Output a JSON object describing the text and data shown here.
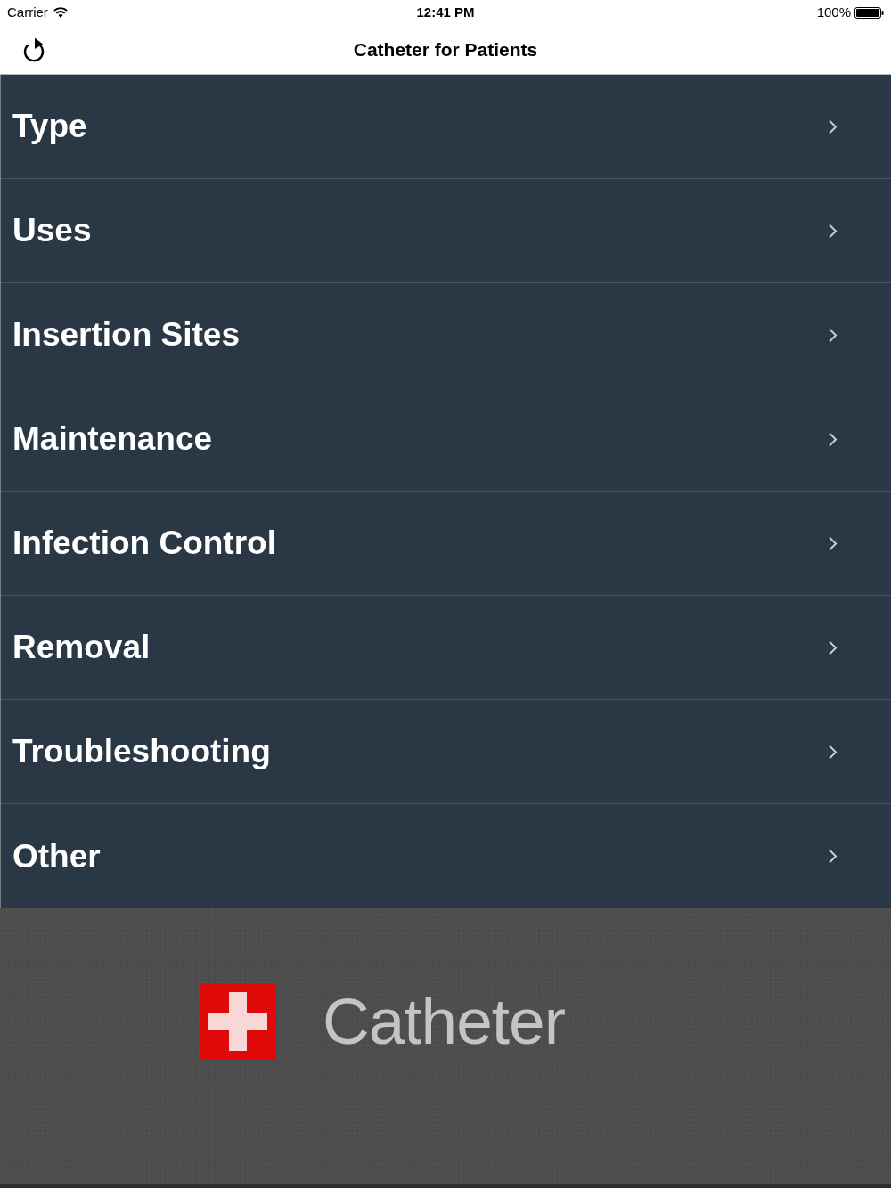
{
  "status_bar": {
    "carrier": "Carrier",
    "time": "12:41 PM",
    "battery": "100%"
  },
  "nav_bar": {
    "title": "Catheter for Patients"
  },
  "menu": {
    "items": [
      {
        "label": "Type"
      },
      {
        "label": "Uses"
      },
      {
        "label": "Insertion Sites"
      },
      {
        "label": "Maintenance"
      },
      {
        "label": "Infection Control"
      },
      {
        "label": "Removal"
      },
      {
        "label": "Troubleshooting"
      },
      {
        "label": "Other"
      }
    ]
  },
  "footer": {
    "logo_text": "Catheter"
  }
}
